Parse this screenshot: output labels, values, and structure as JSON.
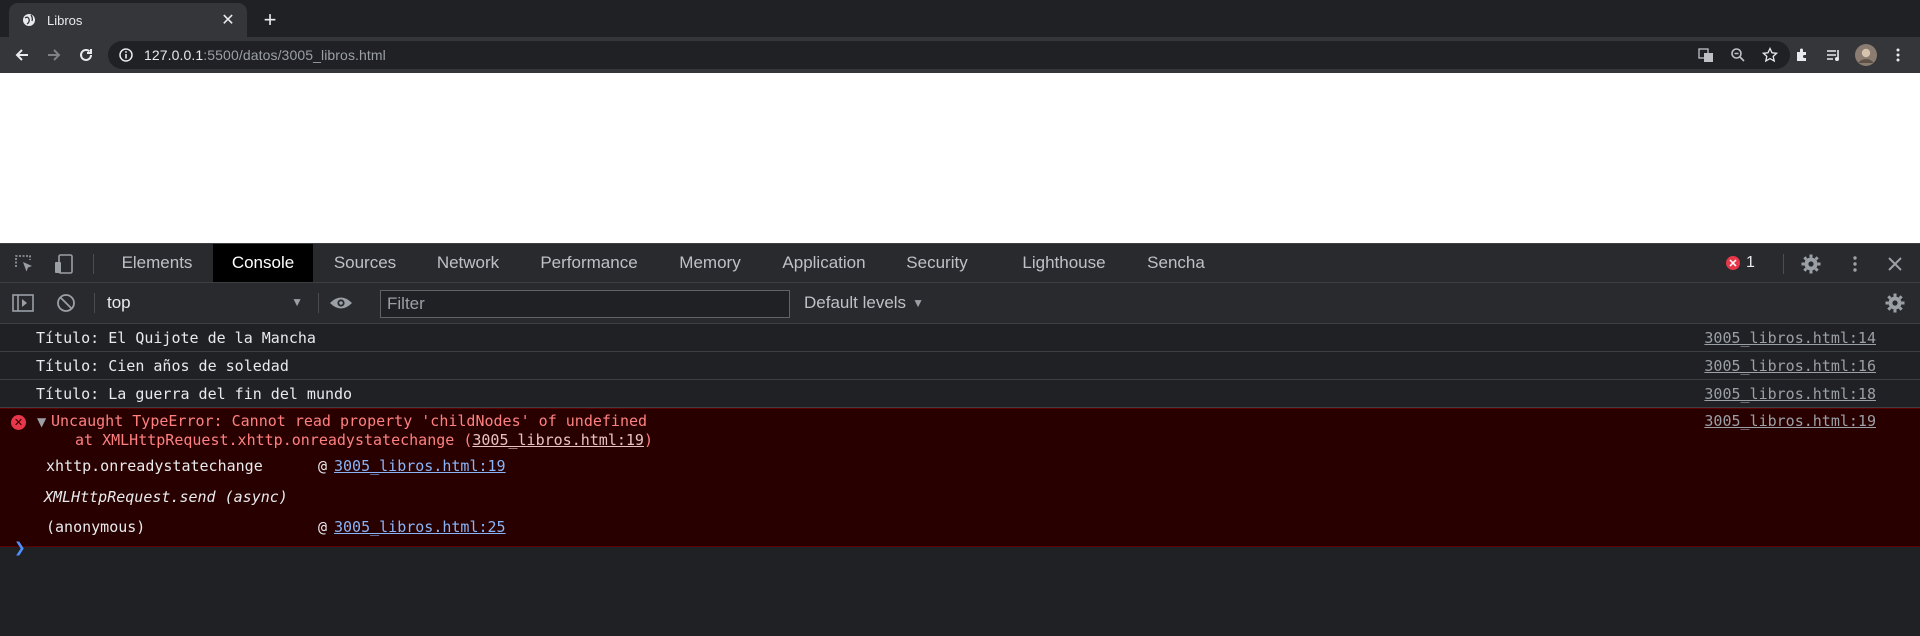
{
  "browser": {
    "tab_title": "Libros",
    "new_tab_icon": "plus-icon",
    "url_host": "127.0.0.1",
    "url_rest": ":5500/datos/3005_libros.html"
  },
  "devtools": {
    "tabs": [
      {
        "label": "Elements"
      },
      {
        "label": "Console"
      },
      {
        "label": "Sources"
      },
      {
        "label": "Network"
      },
      {
        "label": "Performance"
      },
      {
        "label": "Memory"
      },
      {
        "label": "Application"
      },
      {
        "label": "Security"
      },
      {
        "label": "Lighthouse"
      },
      {
        "label": "Sencha"
      }
    ],
    "active_tab": "Console",
    "error_count": "1",
    "context": "top",
    "filter_placeholder": "Filter",
    "levels_label": "Default levels"
  },
  "console": {
    "logs": [
      {
        "text": "Título: El Quijote de la Mancha",
        "source": "3005_libros.html:14"
      },
      {
        "text": "Título: Cien años de soledad",
        "source": "3005_libros.html:16"
      },
      {
        "text": "Título: La guerra del fin del mundo",
        "source": "3005_libros.html:18"
      }
    ],
    "error": {
      "line1": "Uncaught TypeError: Cannot read property 'childNodes' of undefined",
      "line2_prefix": "at XMLHttpRequest.xhttp.onreadystatechange (",
      "line2_link": "3005_libros.html:19",
      "line2_suffix": ")",
      "source": "3005_libros.html:19",
      "stack": [
        {
          "fn": "xhttp.onreadystatechange",
          "at": "@",
          "link": "3005_libros.html:19"
        },
        {
          "fn": "XMLHttpRequest.send (async)"
        },
        {
          "fn": "(anonymous)",
          "at": "@",
          "link": "3005_libros.html:25"
        }
      ]
    }
  },
  "colors": {
    "accent_blue": "#8ab4f8",
    "error_red": "#e8374a",
    "error_bg": "#290000"
  }
}
